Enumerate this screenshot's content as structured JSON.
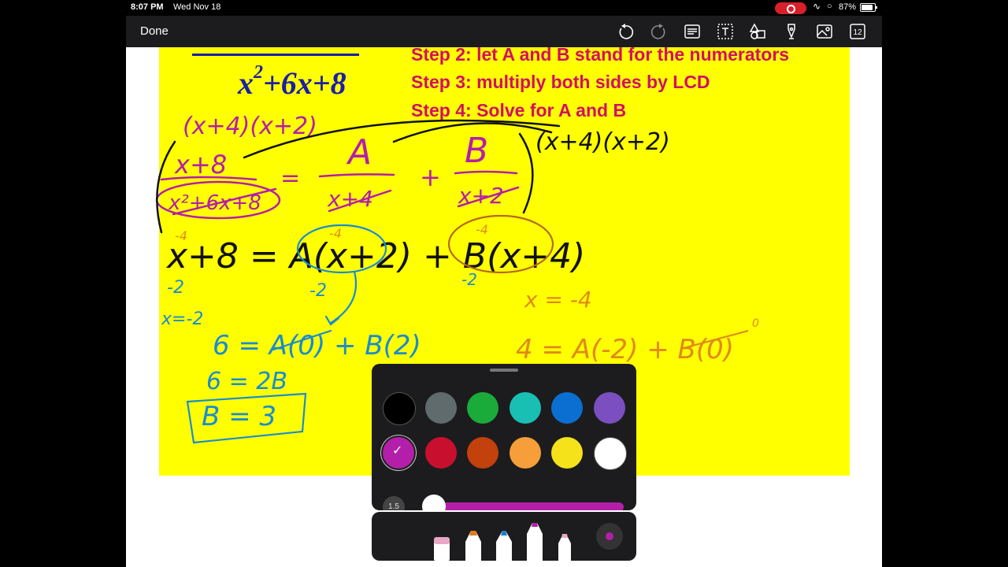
{
  "status": {
    "time": "8:07 PM",
    "date": "Wed Nov 18",
    "battery": "87%"
  },
  "toolbar": {
    "done_label": "Done",
    "buttons": [
      "undo-icon",
      "redo-icon",
      "text-recognition-icon",
      "text-tool-icon",
      "shapes-icon",
      "pen-markup-icon",
      "photo-icon",
      "page-count-icon"
    ],
    "page_count": "12"
  },
  "slide": {
    "denominator_text": "+6x+8",
    "denominator_var": "x",
    "denominator_exp": "2",
    "steps": [
      "Step 2: let A and B stand for the numerators",
      "Step 3: multiply both sides by LCD",
      "Step 4:  Solve for A and B"
    ]
  },
  "handwriting": {
    "lcd_top": "(x+4)(x+2)",
    "numerator": "x+8",
    "denominator": "x²+6x+8",
    "equals": "=",
    "term_a": "A",
    "term_a_den": "x+4",
    "plus": "+",
    "term_b": "B",
    "term_b_den": "x+2",
    "lcd_right": "(x+4)(x+2)",
    "main_eq": "x+8 = A(x+2) + B(x+4)",
    "sub_neg4_a": "-4",
    "sub_neg4_b": "-4",
    "sub_neg4_c": "-4",
    "sub_neg2_a": "-2",
    "sub_neg2_b": "-2",
    "sub_neg2_c": "-2",
    "x_eq_neg2": "x=-2",
    "eq_b1": "6 = A(0) + B(2)",
    "eq_b2": "6 = 2B",
    "eq_b3": "B = 3",
    "x_eq_neg4": "x = -4",
    "eq_a1": "4 = A(-2) + B(0)",
    "zero_mark": "0"
  },
  "colors": {
    "slide_bg": "#ffff00",
    "title_blue": "#1a1fa8",
    "step_pink": "#d21063",
    "ink_magenta": "#b41fa9",
    "ink_blue": "#1a8ccf",
    "ink_orange": "#e08a1a"
  },
  "picker": {
    "row1": [
      "#000000",
      "#5f6b6d",
      "#1aab3a",
      "#1abfb4",
      "#0a6fd1",
      "#7b4fbf"
    ],
    "row2": [
      "#b41fa9",
      "#c8102e",
      "#c2410c",
      "#f59e3a",
      "#f5e21a",
      "#ffffff"
    ],
    "selected_index": 6,
    "thickness_label": "1.5"
  },
  "tray": {
    "tools": [
      "eraser-tool-icon",
      "marker-tool-icon",
      "pen-tool-icon",
      "highlighter-tool-icon",
      "pencil-tool-icon"
    ],
    "color_button": "current-color-icon"
  }
}
